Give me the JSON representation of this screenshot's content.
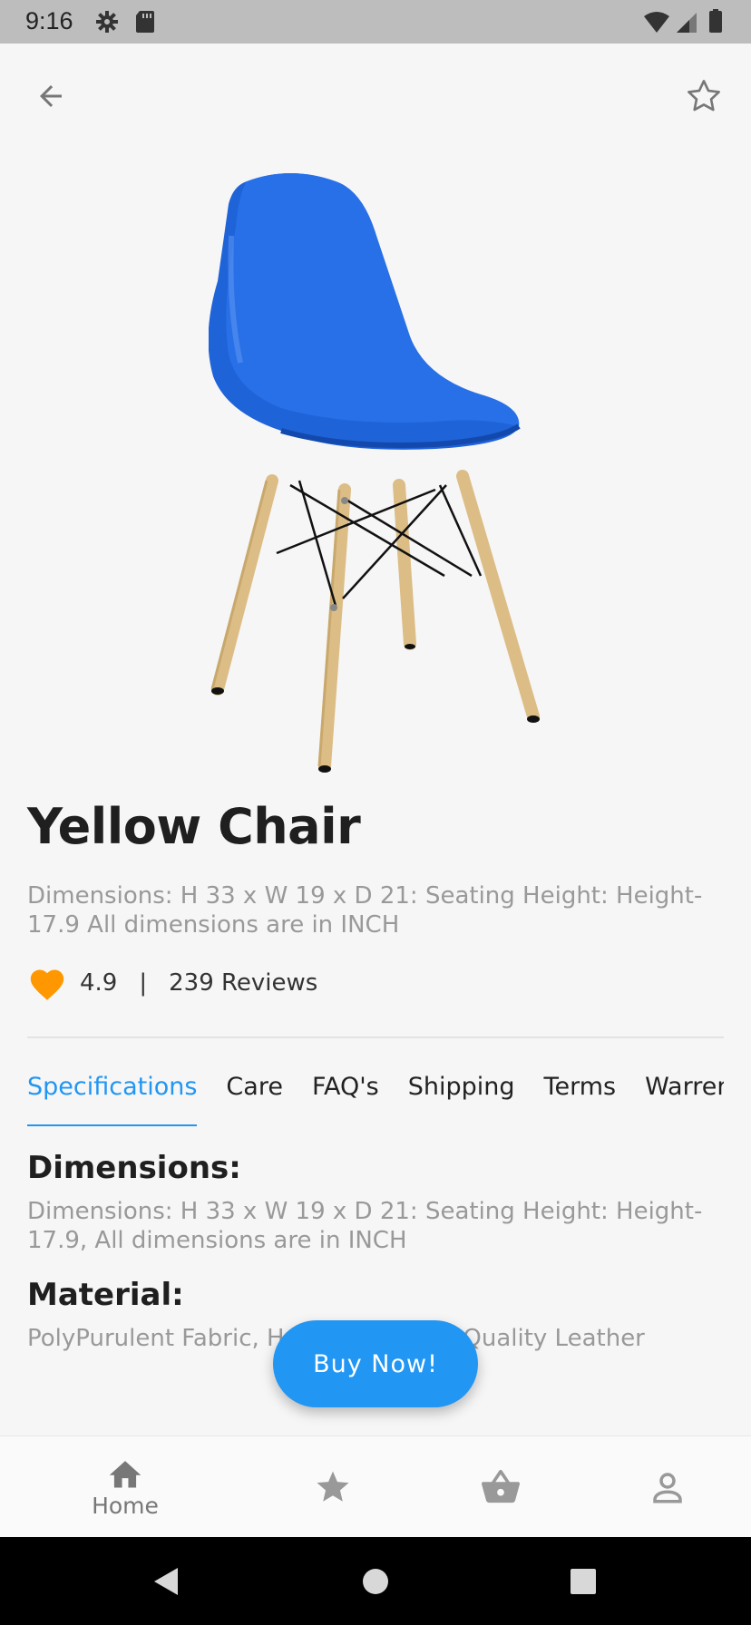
{
  "status_bar": {
    "time": "9:16"
  },
  "product": {
    "title": "Yellow Chair",
    "description": "Dimensions: H 33 x W 19 x D 21: Seating Height: Height-17.9 All dimensions are in INCH",
    "rating": "4.9",
    "separator": "|",
    "reviews": "239 Reviews"
  },
  "tabs": [
    {
      "label": "Specifications",
      "active": true
    },
    {
      "label": "Care"
    },
    {
      "label": "FAQ's"
    },
    {
      "label": "Shipping"
    },
    {
      "label": "Terms"
    },
    {
      "label": "Warrenty"
    }
  ],
  "specs": {
    "dimensions_title": "Dimensions:",
    "dimensions_body": "Dimensions: H 33 x W 19 x D 21: Seating Height: Height-17.9, All dimensions are in INCH",
    "material_title": "Material:",
    "material_body": "PolyPurulent Fabric, Hardwood, High Quality Leather"
  },
  "buy_button": {
    "label": "Buy Now!"
  },
  "bottom_nav": {
    "items": [
      {
        "label": "Home",
        "icon": "home-icon"
      },
      {
        "label": "",
        "icon": "star-icon"
      },
      {
        "label": "",
        "icon": "basket-icon"
      },
      {
        "label": "",
        "icon": "profile-icon"
      }
    ]
  },
  "colors": {
    "accent": "#2196f3",
    "heart": "#ff9800",
    "chair_seat": "#1e63d6",
    "chair_legs": "#e2c48d"
  }
}
